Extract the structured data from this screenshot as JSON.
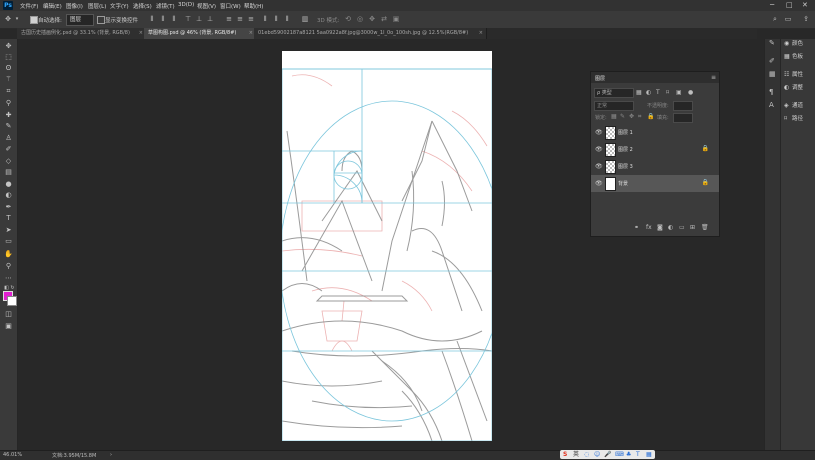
{
  "app": {
    "logo": "Ps"
  },
  "menu": [
    "文件(F)",
    "编辑(E)",
    "图像(I)",
    "图层(L)",
    "文字(Y)",
    "选择(S)",
    "滤镜(T)",
    "3D(D)",
    "视图(V)",
    "窗口(W)",
    "帮助(H)"
  ],
  "window_controls": {
    "minimize": "─",
    "maximize": "□",
    "close": "✕"
  },
  "options": {
    "auto_select_label": "自动选择:",
    "auto_select_value": "图层",
    "show_transform_label": "显示变换控件",
    "mode_3d_label": "3D 模式:"
  },
  "tabs": [
    {
      "label": "古国历史插画例化.psd @ 33.1% (背景, RGB/8)",
      "active": false,
      "close": "×"
    },
    {
      "label": "草图构图.psd @ 46% (背景, RGB/8#)",
      "active": true,
      "close": "×"
    },
    {
      "label": "01ebd59002187a8121 5aa0922a8f.jpg@3000w_1l_0o_100sh.jpg @ 12.5%(RGB/8#)",
      "active": false,
      "close": "×"
    }
  ],
  "tools": [
    "move-icon",
    "marquee-icon",
    "lasso-icon",
    "magic-wand-icon",
    "crop-icon",
    "eyedropper-icon",
    "healing-brush-icon",
    "brush-icon",
    "clone-stamp-icon",
    "history-brush-icon",
    "eraser-icon",
    "gradient-icon",
    "blur-icon",
    "dodge-icon",
    "pen-icon",
    "type-icon",
    "path-selection-icon",
    "rectangle-icon",
    "hand-icon",
    "zoom-icon",
    "more-tools-icon"
  ],
  "colors": {
    "foreground": "#e020d0",
    "background": "#ffffff",
    "guide": "#7cc6dc",
    "sketch_red": "#e8a0a0",
    "sketch_gray": "#8a8a8a"
  },
  "layers_panel": {
    "title": "图层",
    "filter_label": "ρ 类型",
    "blend_mode": "正常",
    "opacity_label": "不透明度:",
    "lock_label": "锁定:",
    "fill_label": "填充:",
    "layers": [
      {
        "name": "图层 1",
        "locked": false,
        "selected": false,
        "thumb": "transparent"
      },
      {
        "name": "图层 2",
        "locked": true,
        "selected": false,
        "thumb": "transparent"
      },
      {
        "name": "图层 3",
        "locked": false,
        "selected": false,
        "thumb": "transparent"
      },
      {
        "name": "背景",
        "locked": true,
        "selected": true,
        "thumb": "white"
      }
    ]
  },
  "right_panels": [
    {
      "icon": "color-icon",
      "label": "颜色"
    },
    {
      "icon": "swatches-icon",
      "label": "色板"
    },
    {
      "icon": "properties-icon",
      "label": "属性"
    },
    {
      "icon": "adjustments-icon",
      "label": "调整"
    },
    {
      "icon": "channels-icon",
      "label": "通道"
    },
    {
      "icon": "paths-icon",
      "label": "路径"
    }
  ],
  "status": {
    "zoom": "46.01%",
    "doc": "文档:3.95M/15.8M",
    "arrow": "›"
  },
  "ime": {
    "logo": "S",
    "label": "英"
  }
}
